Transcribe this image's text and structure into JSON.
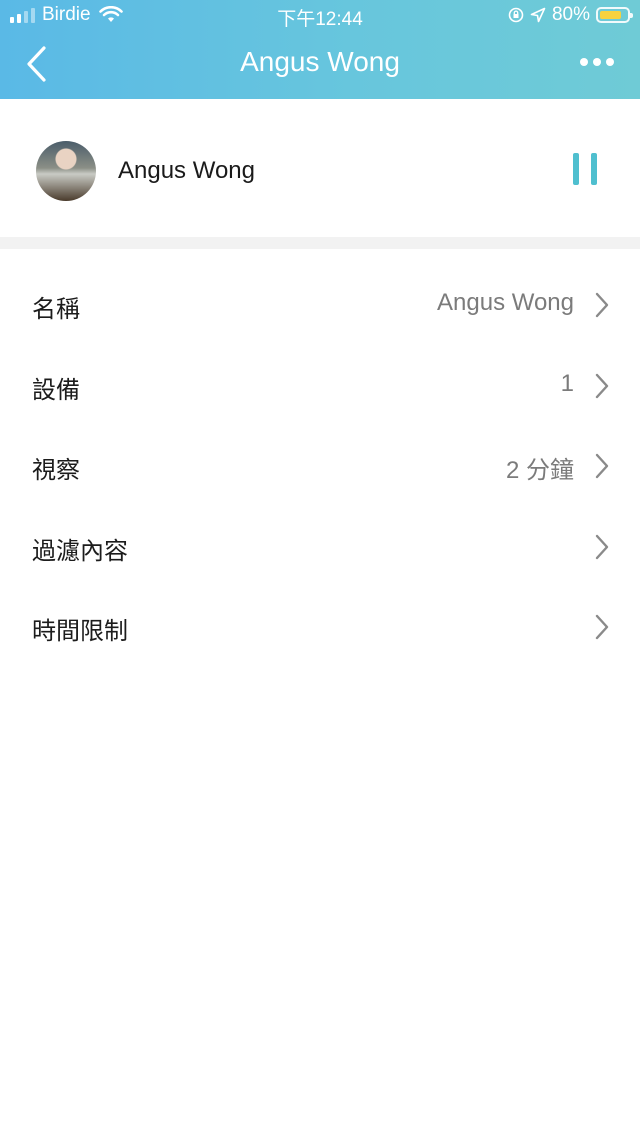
{
  "status_bar": {
    "carrier": "Birdie",
    "time": "下午12:44",
    "battery_percent": "80%",
    "battery_level": 0.8,
    "icons": [
      "signal-icon",
      "wifi-icon",
      "rotation-lock-icon",
      "location-arrow-icon",
      "battery-icon"
    ],
    "battery_color": "#f7d23e"
  },
  "nav": {
    "title": "Angus Wong",
    "back_icon": "chevron-left-icon",
    "more_icon": "more-horizontal-icon"
  },
  "profile": {
    "name": "Angus Wong",
    "pause_icon": "pause-icon",
    "accent_color": "#4fbfcf"
  },
  "settings": [
    {
      "label": "名稱",
      "value": "Angus Wong"
    },
    {
      "label": "設備",
      "value": "1"
    },
    {
      "label": "視察",
      "value": "2 分鐘"
    },
    {
      "label": "過濾內容",
      "value": ""
    },
    {
      "label": "時間限制",
      "value": ""
    }
  ]
}
